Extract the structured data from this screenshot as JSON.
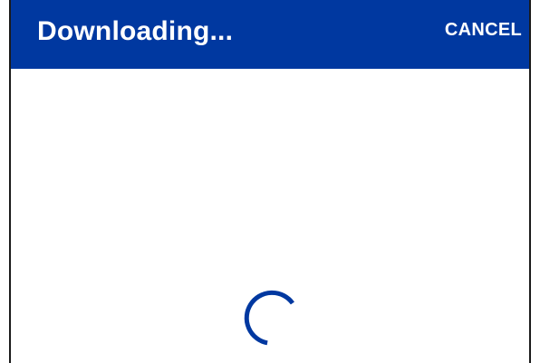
{
  "dialog": {
    "title": "Downloading...",
    "cancel_label": "CANCEL"
  },
  "spinner": {
    "icon": "loading-spinner-icon",
    "color": "#0038a0"
  },
  "colors": {
    "header_bg": "#0038a0",
    "header_text": "#ffffff",
    "body_bg": "#ffffff"
  }
}
